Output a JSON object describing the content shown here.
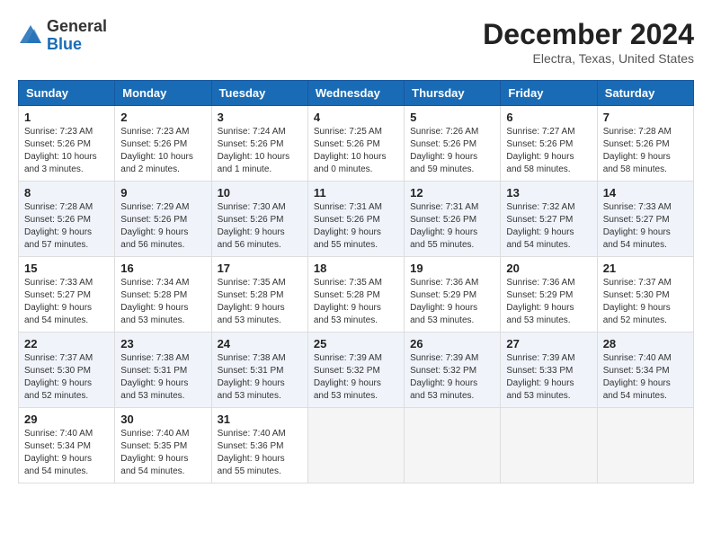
{
  "header": {
    "logo_general": "General",
    "logo_blue": "Blue",
    "month_title": "December 2024",
    "location": "Electra, Texas, United States"
  },
  "weekdays": [
    "Sunday",
    "Monday",
    "Tuesday",
    "Wednesday",
    "Thursday",
    "Friday",
    "Saturday"
  ],
  "weeks": [
    [
      {
        "day": 1,
        "info": "Sunrise: 7:23 AM\nSunset: 5:26 PM\nDaylight: 10 hours\nand 3 minutes."
      },
      {
        "day": 2,
        "info": "Sunrise: 7:23 AM\nSunset: 5:26 PM\nDaylight: 10 hours\nand 2 minutes."
      },
      {
        "day": 3,
        "info": "Sunrise: 7:24 AM\nSunset: 5:26 PM\nDaylight: 10 hours\nand 1 minute."
      },
      {
        "day": 4,
        "info": "Sunrise: 7:25 AM\nSunset: 5:26 PM\nDaylight: 10 hours\nand 0 minutes."
      },
      {
        "day": 5,
        "info": "Sunrise: 7:26 AM\nSunset: 5:26 PM\nDaylight: 9 hours\nand 59 minutes."
      },
      {
        "day": 6,
        "info": "Sunrise: 7:27 AM\nSunset: 5:26 PM\nDaylight: 9 hours\nand 58 minutes."
      },
      {
        "day": 7,
        "info": "Sunrise: 7:28 AM\nSunset: 5:26 PM\nDaylight: 9 hours\nand 58 minutes."
      }
    ],
    [
      {
        "day": 8,
        "info": "Sunrise: 7:28 AM\nSunset: 5:26 PM\nDaylight: 9 hours\nand 57 minutes."
      },
      {
        "day": 9,
        "info": "Sunrise: 7:29 AM\nSunset: 5:26 PM\nDaylight: 9 hours\nand 56 minutes."
      },
      {
        "day": 10,
        "info": "Sunrise: 7:30 AM\nSunset: 5:26 PM\nDaylight: 9 hours\nand 56 minutes."
      },
      {
        "day": 11,
        "info": "Sunrise: 7:31 AM\nSunset: 5:26 PM\nDaylight: 9 hours\nand 55 minutes."
      },
      {
        "day": 12,
        "info": "Sunrise: 7:31 AM\nSunset: 5:26 PM\nDaylight: 9 hours\nand 55 minutes."
      },
      {
        "day": 13,
        "info": "Sunrise: 7:32 AM\nSunset: 5:27 PM\nDaylight: 9 hours\nand 54 minutes."
      },
      {
        "day": 14,
        "info": "Sunrise: 7:33 AM\nSunset: 5:27 PM\nDaylight: 9 hours\nand 54 minutes."
      }
    ],
    [
      {
        "day": 15,
        "info": "Sunrise: 7:33 AM\nSunset: 5:27 PM\nDaylight: 9 hours\nand 54 minutes."
      },
      {
        "day": 16,
        "info": "Sunrise: 7:34 AM\nSunset: 5:28 PM\nDaylight: 9 hours\nand 53 minutes."
      },
      {
        "day": 17,
        "info": "Sunrise: 7:35 AM\nSunset: 5:28 PM\nDaylight: 9 hours\nand 53 minutes."
      },
      {
        "day": 18,
        "info": "Sunrise: 7:35 AM\nSunset: 5:28 PM\nDaylight: 9 hours\nand 53 minutes."
      },
      {
        "day": 19,
        "info": "Sunrise: 7:36 AM\nSunset: 5:29 PM\nDaylight: 9 hours\nand 53 minutes."
      },
      {
        "day": 20,
        "info": "Sunrise: 7:36 AM\nSunset: 5:29 PM\nDaylight: 9 hours\nand 53 minutes."
      },
      {
        "day": 21,
        "info": "Sunrise: 7:37 AM\nSunset: 5:30 PM\nDaylight: 9 hours\nand 52 minutes."
      }
    ],
    [
      {
        "day": 22,
        "info": "Sunrise: 7:37 AM\nSunset: 5:30 PM\nDaylight: 9 hours\nand 52 minutes."
      },
      {
        "day": 23,
        "info": "Sunrise: 7:38 AM\nSunset: 5:31 PM\nDaylight: 9 hours\nand 53 minutes."
      },
      {
        "day": 24,
        "info": "Sunrise: 7:38 AM\nSunset: 5:31 PM\nDaylight: 9 hours\nand 53 minutes."
      },
      {
        "day": 25,
        "info": "Sunrise: 7:39 AM\nSunset: 5:32 PM\nDaylight: 9 hours\nand 53 minutes."
      },
      {
        "day": 26,
        "info": "Sunrise: 7:39 AM\nSunset: 5:32 PM\nDaylight: 9 hours\nand 53 minutes."
      },
      {
        "day": 27,
        "info": "Sunrise: 7:39 AM\nSunset: 5:33 PM\nDaylight: 9 hours\nand 53 minutes."
      },
      {
        "day": 28,
        "info": "Sunrise: 7:40 AM\nSunset: 5:34 PM\nDaylight: 9 hours\nand 54 minutes."
      }
    ],
    [
      {
        "day": 29,
        "info": "Sunrise: 7:40 AM\nSunset: 5:34 PM\nDaylight: 9 hours\nand 54 minutes."
      },
      {
        "day": 30,
        "info": "Sunrise: 7:40 AM\nSunset: 5:35 PM\nDaylight: 9 hours\nand 54 minutes."
      },
      {
        "day": 31,
        "info": "Sunrise: 7:40 AM\nSunset: 5:36 PM\nDaylight: 9 hours\nand 55 minutes."
      },
      null,
      null,
      null,
      null
    ]
  ]
}
